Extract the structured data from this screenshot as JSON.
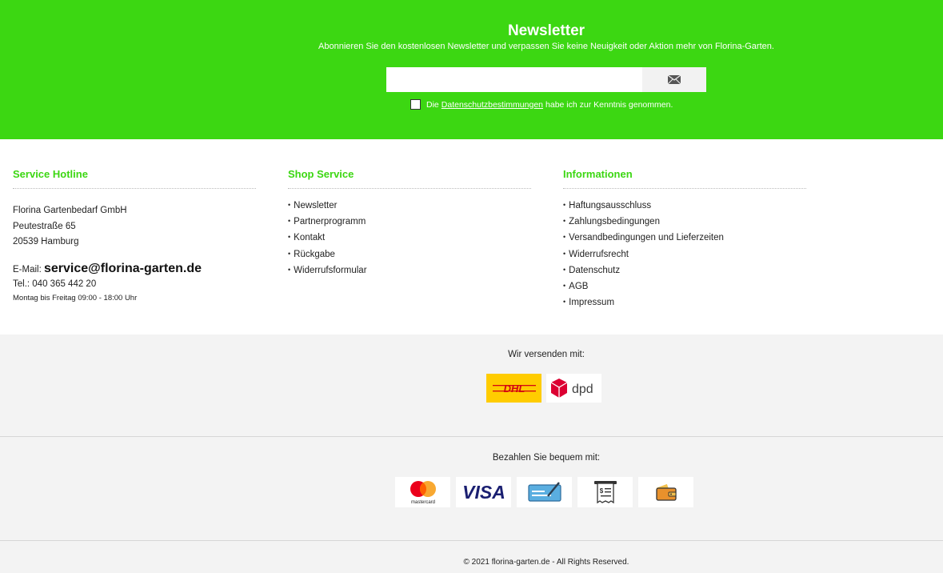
{
  "newsletter": {
    "title": "Newsletter",
    "subtitle": "Abonnieren Sie den kostenlosen Newsletter und verpassen Sie keine Neuigkeit oder Aktion mehr von Florina-Garten.",
    "email_placeholder": "",
    "submit_icon": "envelope-icon",
    "consent_prefix": "Die",
    "consent_link": "Datenschutzbestimmungen",
    "consent_suffix": "habe ich zur Kenntnis genommen."
  },
  "hotline": {
    "title": "Service Hotline",
    "company": "Florina Gartenbedarf GmbH",
    "street": "Peutestraße 65",
    "city": "20539 Hamburg",
    "email_label": "E-Mail:",
    "email": "service@florina-garten.de",
    "tel": "Tel.: 040 365 442 20",
    "hours": "Montag bis Freitag 09:00 - 18:00 Uhr"
  },
  "shop_service": {
    "title": "Shop Service",
    "items": [
      "Newsletter",
      "Partnerprogramm",
      "Kontakt",
      "Rückgabe",
      "Widerrufsformular"
    ]
  },
  "informationen": {
    "title": "Informationen",
    "items": [
      "Haftungsausschluss",
      "Zahlungsbedingungen",
      "Versandbedingungen und Lieferzeiten",
      "Widerrufsrecht",
      "Datenschutz",
      "AGB",
      "Impressum"
    ]
  },
  "shipping": {
    "label": "Wir versenden mit:",
    "dhl_text": "DHL",
    "dpd_text": "dpd"
  },
  "payment": {
    "label": "Bezahlen Sie bequem mit:",
    "mastercard_text": "mastercard",
    "visa_text": "VISA",
    "methods": [
      "mastercard",
      "visa",
      "check",
      "invoice",
      "wallet"
    ]
  },
  "copyright": "© 2021 florina-garten.de - All Rights Reserved.",
  "colors": {
    "brand_green": "#3cd712",
    "dhl_yellow": "#ffcc00",
    "dhl_red": "#d40511",
    "dpd_red": "#dc0032"
  }
}
